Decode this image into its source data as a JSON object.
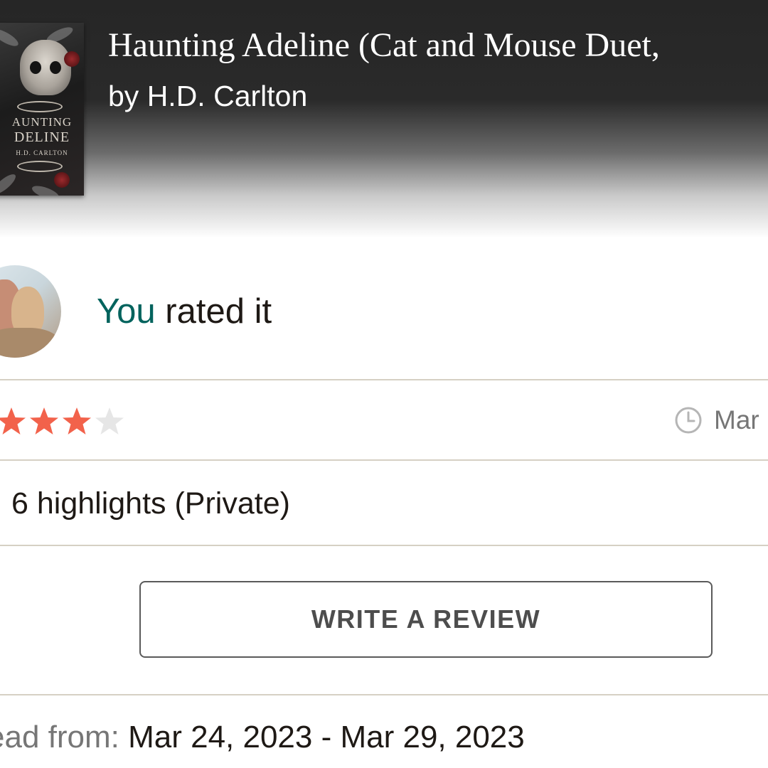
{
  "book": {
    "title": "Haunting Adeline (Cat and Mouse Duet,",
    "author": "by H.D. Carlton",
    "cover": {
      "title_line1": "AUNTING",
      "title_line2": "DELINE",
      "author": "H.D. CARLTON"
    }
  },
  "rating_section": {
    "you": "You",
    "rated_text": " rated it",
    "stars_filled": 3,
    "stars_total": 4,
    "star_color_filled": "#f2624b",
    "star_color_empty": "#e6e6e6",
    "date_short": "Mar"
  },
  "highlights": {
    "label": "6 highlights (Private)"
  },
  "review": {
    "button_label": "WRITE A REVIEW"
  },
  "read_dates": {
    "label": "ead from: ",
    "value": "Mar 24, 2023 - Mar 29, 2023"
  },
  "colors": {
    "accent_teal": "#00635d",
    "divider": "#d6d0c4",
    "muted_text": "#767676"
  },
  "icons": {
    "clock": "clock-icon",
    "star": "star-icon"
  }
}
